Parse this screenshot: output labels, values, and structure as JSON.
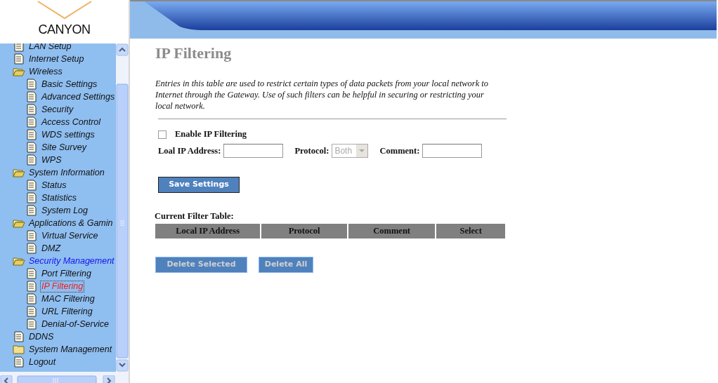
{
  "header": {
    "logo": "CANYON"
  },
  "sidebar": {
    "items": [
      {
        "label": "LAN Setup",
        "kind": "page",
        "selected": false,
        "current": false
      },
      {
        "label": "Internet Setup",
        "kind": "page",
        "selected": false,
        "current": false
      },
      {
        "label": "Wireless",
        "kind": "folder",
        "expanded": true,
        "selected": false,
        "current": false,
        "children": [
          {
            "label": "Basic Settings",
            "kind": "page",
            "selected": false,
            "current": false
          },
          {
            "label": "Advanced Settings",
            "kind": "page",
            "selected": false,
            "current": false
          },
          {
            "label": "Security",
            "kind": "page",
            "selected": false,
            "current": false
          },
          {
            "label": "Access Control",
            "kind": "page",
            "selected": false,
            "current": false
          },
          {
            "label": "WDS settings",
            "kind": "page",
            "selected": false,
            "current": false
          },
          {
            "label": "Site Survey",
            "kind": "page",
            "selected": false,
            "current": false
          },
          {
            "label": "WPS",
            "kind": "page",
            "selected": false,
            "current": false
          }
        ]
      },
      {
        "label": "System Information",
        "kind": "folder",
        "expanded": true,
        "selected": false,
        "current": false,
        "children": [
          {
            "label": "Status",
            "kind": "page",
            "selected": false,
            "current": false
          },
          {
            "label": "Statistics",
            "kind": "page",
            "selected": false,
            "current": false
          },
          {
            "label": "System Log",
            "kind": "page",
            "selected": false,
            "current": false
          }
        ]
      },
      {
        "label": "Applications & Gamin",
        "kind": "folder",
        "expanded": true,
        "selected": false,
        "current": false,
        "children": [
          {
            "label": "Virtual Service",
            "kind": "page",
            "selected": false,
            "current": false
          },
          {
            "label": "DMZ",
            "kind": "page",
            "selected": false,
            "current": false
          }
        ]
      },
      {
        "label": "Security Management",
        "kind": "folder",
        "expanded": true,
        "selected": false,
        "current": true,
        "children": [
          {
            "label": "Port Filtering",
            "kind": "page",
            "selected": false,
            "current": false
          },
          {
            "label": "IP Filtering",
            "kind": "page",
            "selected": true,
            "current": false
          },
          {
            "label": "MAC Filtering",
            "kind": "page",
            "selected": false,
            "current": false
          },
          {
            "label": "URL Filtering",
            "kind": "page",
            "selected": false,
            "current": false
          },
          {
            "label": "Denial-of-Service",
            "kind": "page",
            "selected": false,
            "current": false
          }
        ]
      },
      {
        "label": "DDNS",
        "kind": "page",
        "selected": false,
        "current": false
      },
      {
        "label": "System Management",
        "kind": "folder",
        "expanded": false,
        "selected": false,
        "current": false
      },
      {
        "label": "Logout",
        "kind": "page",
        "selected": false,
        "current": false
      }
    ]
  },
  "page": {
    "title": "IP Filtering",
    "description": "Entries in this table are used to restrict certain types of data packets from your local network to Internet through the Gateway. Use of such filters can be helpful in securing or restricting your local network.",
    "enable": {
      "label": "Enable IP Filtering",
      "checked": false
    },
    "fields": [
      {
        "kind": "input",
        "label": "Loal IP Address:"
      },
      {
        "kind": "select",
        "label": "Protocol:",
        "value": "Both",
        "disabled": true
      },
      {
        "kind": "input",
        "label": "Comment:"
      }
    ],
    "save_button": {
      "label": "Save Settings",
      "disabled": false
    },
    "table": {
      "caption": "Current Filter Table:",
      "columns": [
        "Local IP Address",
        "Protocol",
        "Comment",
        "Select"
      ]
    },
    "buttons": [
      {
        "label": "Delete Selected",
        "disabled": true
      },
      {
        "label": "Delete All",
        "disabled": true
      }
    ]
  }
}
